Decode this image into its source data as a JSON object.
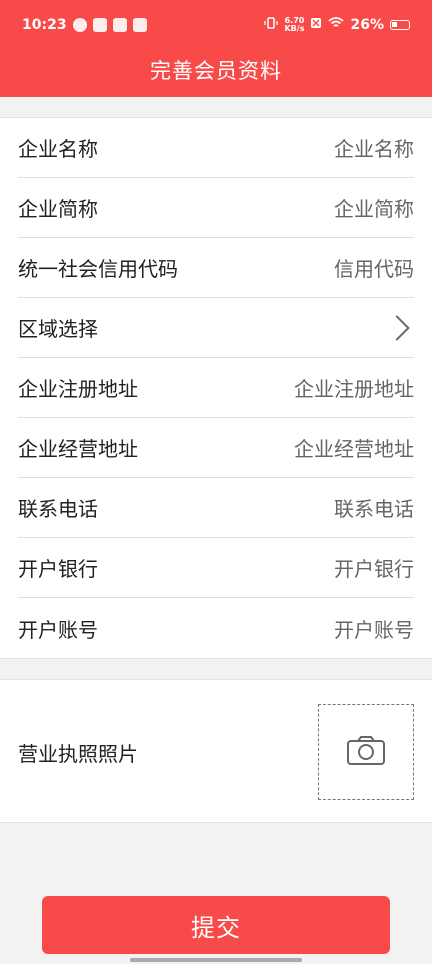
{
  "status": {
    "time": "10:23",
    "speed_top": "6.70",
    "speed_bottom": "KB/s",
    "battery": "26%"
  },
  "header": {
    "title": "完善会员资料"
  },
  "form": {
    "rows": [
      {
        "label": "企业名称",
        "placeholder": "企业名称"
      },
      {
        "label": "企业简称",
        "placeholder": "企业简称"
      },
      {
        "label": "统一社会信用代码",
        "placeholder": "信用代码"
      },
      {
        "label": "区域选择",
        "placeholder": ""
      },
      {
        "label": "企业注册地址",
        "placeholder": "企业注册地址"
      },
      {
        "label": "企业经营地址",
        "placeholder": "企业经营地址"
      },
      {
        "label": "联系电话",
        "placeholder": "联系电话"
      },
      {
        "label": "开户银行",
        "placeholder": "开户银行"
      },
      {
        "label": "开户账号",
        "placeholder": "开户账号"
      }
    ]
  },
  "photo": {
    "label": "营业执照照片"
  },
  "actions": {
    "submit": "提交"
  }
}
